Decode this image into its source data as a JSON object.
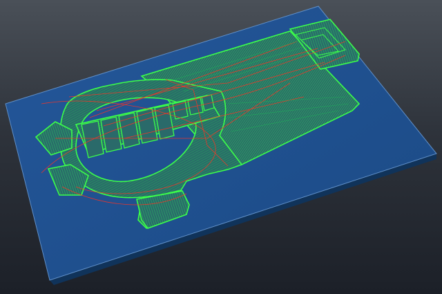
{
  "viewport": {
    "background_top": "#4a5058",
    "background_bottom": "#1c2028"
  },
  "board": {
    "material_color": "#1e4f8c",
    "edge_color": "#5f8fc8",
    "side_color": "#143a66"
  },
  "toolpaths": {
    "cut_color": "#1fb35a",
    "outline_color": "#3cff4a",
    "rapid_color": "#ff3322",
    "fill_color": "#2a6a6a"
  },
  "part": {
    "shape": "guitar-body-with-fretboard",
    "icon": "ring-with-lobes"
  }
}
